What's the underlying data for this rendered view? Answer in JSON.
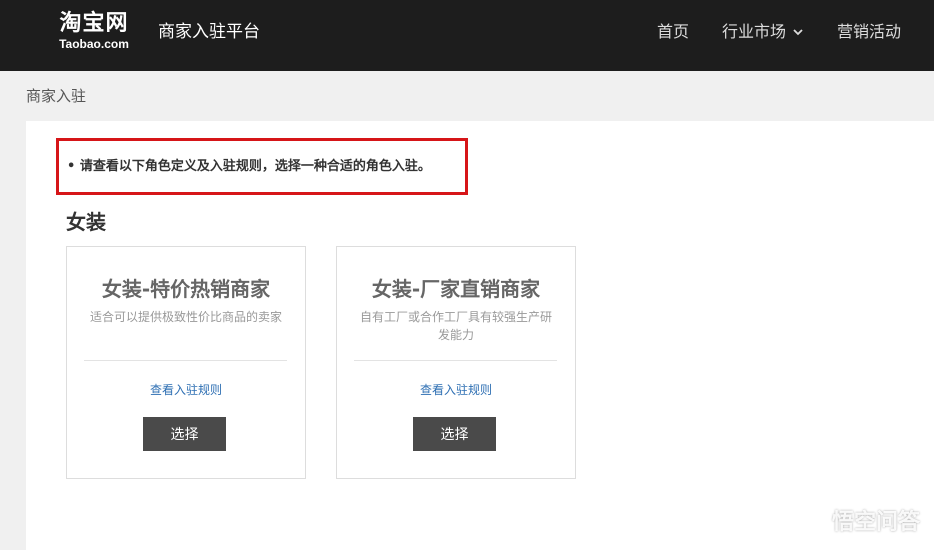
{
  "header": {
    "logo_cn": "淘宝网",
    "logo_en": "Taobao.com",
    "platform_title": "商家入驻平台",
    "nav": [
      {
        "label": "首页"
      },
      {
        "label": "行业市场"
      },
      {
        "label": "营销活动"
      }
    ]
  },
  "breadcrumb": "商家入驻",
  "notice": "• 请查看以下角色定义及入驻规则，选择一种合适的角色入驻。",
  "section_title": "女装",
  "cards": [
    {
      "title": "女装-特价热销商家",
      "description": "适合可以提供极致性价比商品的卖家",
      "link": "查看入驻规则",
      "button": "选择"
    },
    {
      "title": "女装-厂家直销商家",
      "description": "自有工厂或合作工厂具有较强生产研发能力",
      "link": "查看入驻规则",
      "button": "选择"
    }
  ],
  "watermark": "悟空问答",
  "colors": {
    "header_bg": "#1d1d1d",
    "notice_border": "#d61518",
    "link": "#2e6fb3",
    "button_bg": "#4a4a4a"
  }
}
